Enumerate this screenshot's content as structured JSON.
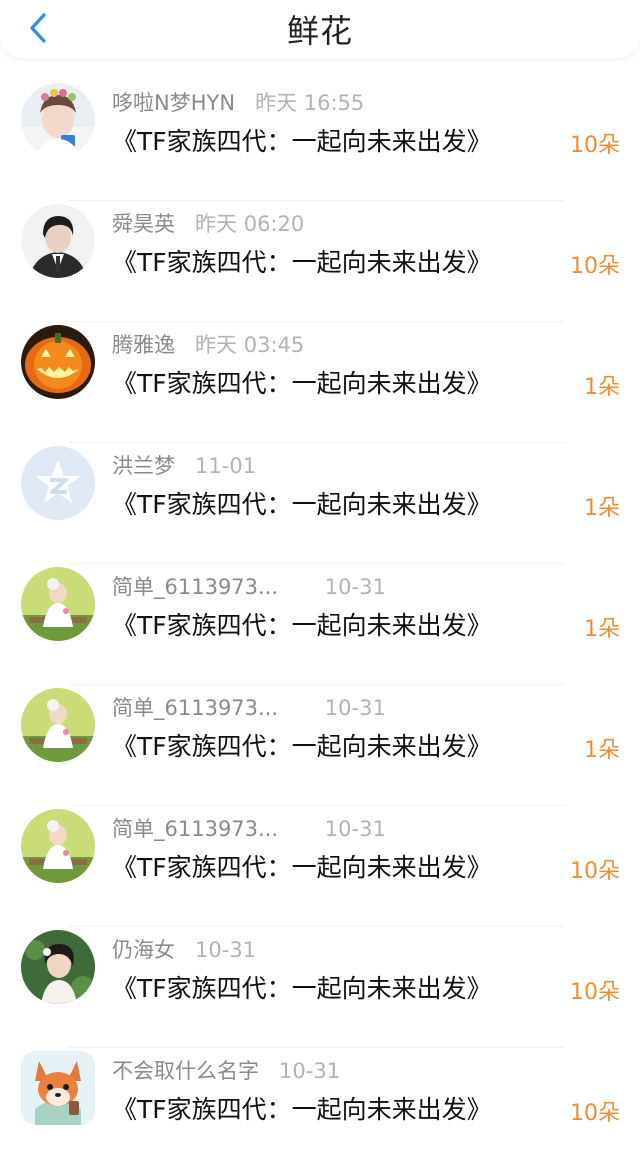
{
  "header": {
    "title": "鲜花",
    "back_icon": "chevron-left-icon",
    "accent": "#2d8fe3"
  },
  "items": [
    {
      "name": "哆啦N梦HYN",
      "time": "昨天 16:55",
      "message": "《TF家族四代：一起向未来出发》",
      "count": "10朵",
      "avatar": "girl-photo"
    },
    {
      "name": "舜昊英",
      "time": "昨天 06:20",
      "message": "《TF家族四代：一起向未来出发》",
      "count": "10朵",
      "avatar": "man-in-suit"
    },
    {
      "name": "腾雅逸",
      "time": "昨天 03:45",
      "message": "《TF家族四代：一起向未来出发》",
      "count": "1朵",
      "avatar": "pumpkin"
    },
    {
      "name": "洪兰梦",
      "time": "11-01",
      "message": "《TF家族四代：一起向未来出发》",
      "count": "1朵",
      "avatar": "default-star"
    },
    {
      "name": "简单_6113973...",
      "time": "10-31",
      "message": "《TF家族四代：一起向未来出发》",
      "count": "1朵",
      "avatar": "girl-on-bench"
    },
    {
      "name": "简单_6113973...",
      "time": "10-31",
      "message": "《TF家族四代：一起向未来出发》",
      "count": "1朵",
      "avatar": "girl-on-bench"
    },
    {
      "name": "简单_6113973...",
      "time": "10-31",
      "message": "《TF家族四代：一起向未来出发》",
      "count": "10朵",
      "avatar": "girl-on-bench"
    },
    {
      "name": "仍海女",
      "time": "10-31",
      "message": "《TF家族四代：一起向未来出发》",
      "count": "10朵",
      "avatar": "girl-with-flowers"
    },
    {
      "name": "不会取什么名字",
      "time": "10-31",
      "message": "《TF家族四代：一起向未来出发》",
      "count": "10朵",
      "avatar": "cartoon-fox"
    }
  ],
  "colors": {
    "count": "#f08c34",
    "name": "#8a8a8a",
    "time": "#b3b3b3"
  }
}
